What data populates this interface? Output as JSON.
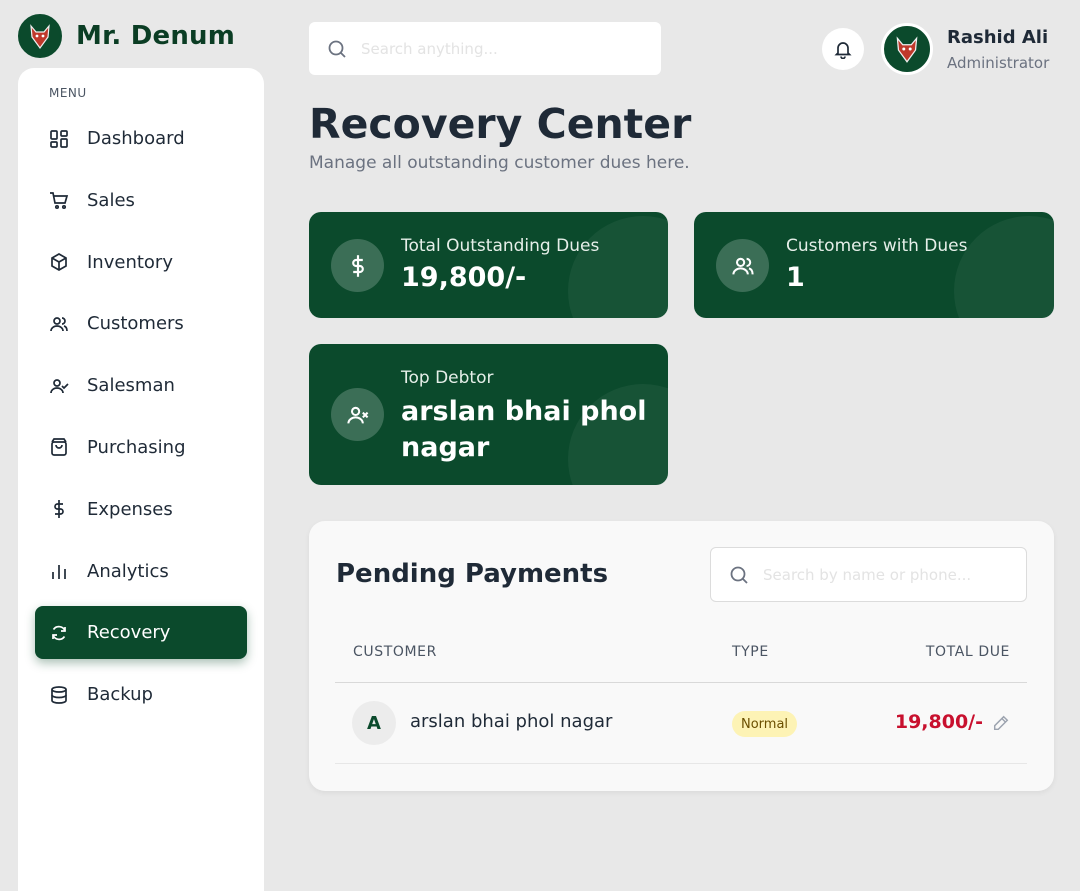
{
  "brand": {
    "name": "Mr. Denum",
    "icon": "wolf-logo-icon"
  },
  "sidebar": {
    "menu_label": "MENU",
    "items": [
      {
        "label": "Dashboard",
        "icon": "dashboard-grid-icon"
      },
      {
        "label": "Sales",
        "icon": "cart-icon"
      },
      {
        "label": "Inventory",
        "icon": "box-icon"
      },
      {
        "label": "Customers",
        "icon": "users-icon"
      },
      {
        "label": "Salesman",
        "icon": "user-check-icon"
      },
      {
        "label": "Purchasing",
        "icon": "shopping-bag-icon"
      },
      {
        "label": "Expenses",
        "icon": "dollar-icon"
      },
      {
        "label": "Analytics",
        "icon": "bar-chart-icon"
      },
      {
        "label": "Recovery",
        "icon": "refresh-icon",
        "active": true
      },
      {
        "label": "Backup",
        "icon": "database-icon"
      }
    ]
  },
  "header": {
    "search_placeholder": "Search anything...",
    "user": {
      "name": "Rashid Ali",
      "role": "Administrator"
    }
  },
  "page": {
    "title": "Recovery Center",
    "subtitle": "Manage all outstanding customer dues here."
  },
  "stats": {
    "total_dues": {
      "label": "Total Outstanding Dues",
      "value": "19,800/-"
    },
    "customers_with_dues": {
      "label": "Customers with Dues",
      "value": "1"
    },
    "top_debtor": {
      "label": "Top Debtor",
      "value": "arslan bhai phol nagar"
    }
  },
  "pending": {
    "title": "Pending Payments",
    "search_placeholder": "Search by name or phone...",
    "columns": {
      "customer": "CUSTOMER",
      "type": "TYPE",
      "total_due": "TOTAL DUE"
    },
    "rows": [
      {
        "initial": "A",
        "name": "arslan bhai phol nagar",
        "type": "Normal",
        "total_due": "19,800/-"
      }
    ]
  },
  "colors": {
    "primary": "#0b4a2c",
    "due": "#c8102e",
    "badge_bg": "#fdf3b5"
  }
}
